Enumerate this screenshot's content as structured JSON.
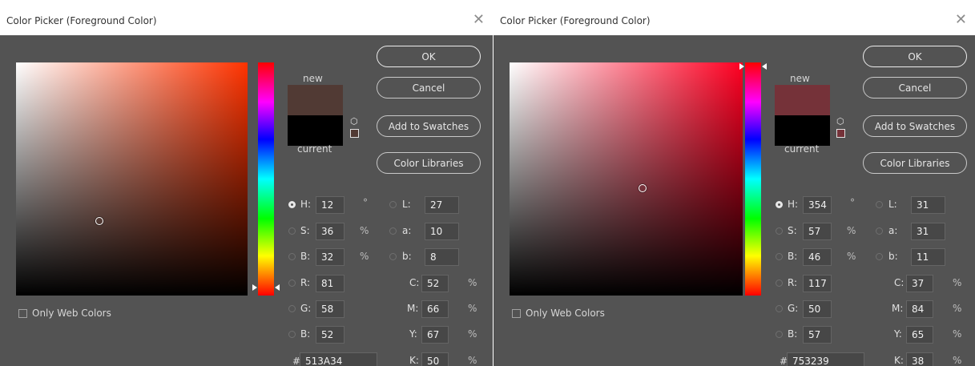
{
  "dialogs": [
    {
      "title": "Color Picker (Foreground Color)",
      "ok_label": "OK",
      "cancel_label": "Cancel",
      "add_swatches_label": "Add to Swatches",
      "libraries_label": "Color Libraries",
      "new_label": "new",
      "current_label": "current",
      "web_colors_label": "Only Web Colors",
      "hue_color": "#ff3300",
      "new_color": "#513A34",
      "current_color": "#000000",
      "selected_mode": "H",
      "fields": {
        "H": {
          "label": "H:",
          "value": "12",
          "unit": "°"
        },
        "S": {
          "label": "S:",
          "value": "36",
          "unit": "%"
        },
        "Bv": {
          "label": "B:",
          "value": "32",
          "unit": "%"
        },
        "L": {
          "label": "L:",
          "value": "27"
        },
        "a": {
          "label": "a:",
          "value": "10"
        },
        "b": {
          "label": "b:",
          "value": "8"
        },
        "R": {
          "label": "R:",
          "value": "81"
        },
        "G": {
          "label": "G:",
          "value": "58"
        },
        "Bc": {
          "label": "B:",
          "value": "52"
        },
        "C": {
          "label": "C:",
          "value": "52",
          "unit": "%"
        },
        "M": {
          "label": "M:",
          "value": "66",
          "unit": "%"
        },
        "Y": {
          "label": "Y:",
          "value": "67",
          "unit": "%"
        },
        "K": {
          "label": "K:",
          "value": "50",
          "unit": "%"
        }
      },
      "hex_label": "#",
      "hex_value": "513A34",
      "saturation_fraction": 0.36,
      "brightness_fraction": 0.32,
      "hue_degrees": 12
    },
    {
      "title": "Color Picker (Foreground Color)",
      "ok_label": "OK",
      "cancel_label": "Cancel",
      "add_swatches_label": "Add to Swatches",
      "libraries_label": "Color Libraries",
      "new_label": "new",
      "current_label": "current",
      "web_colors_label": "Only Web Colors",
      "hue_color": "#ff0022",
      "new_color": "#753239",
      "current_color": "#000000",
      "selected_mode": "H",
      "fields": {
        "H": {
          "label": "H:",
          "value": "354",
          "unit": "°"
        },
        "S": {
          "label": "S:",
          "value": "57",
          "unit": "%"
        },
        "Bv": {
          "label": "B:",
          "value": "46",
          "unit": "%"
        },
        "L": {
          "label": "L:",
          "value": "31"
        },
        "a": {
          "label": "a:",
          "value": "31"
        },
        "b": {
          "label": "b:",
          "value": "11"
        },
        "R": {
          "label": "R:",
          "value": "117"
        },
        "G": {
          "label": "G:",
          "value": "50"
        },
        "Bc": {
          "label": "B:",
          "value": "57"
        },
        "C": {
          "label": "C:",
          "value": "37",
          "unit": "%"
        },
        "M": {
          "label": "M:",
          "value": "84",
          "unit": "%"
        },
        "Y": {
          "label": "Y:",
          "value": "65",
          "unit": "%"
        },
        "K": {
          "label": "K:",
          "value": "38",
          "unit": "%"
        }
      },
      "hex_label": "#",
      "hex_value": "753239",
      "saturation_fraction": 0.57,
      "brightness_fraction": 0.46,
      "hue_degrees": 354
    }
  ]
}
